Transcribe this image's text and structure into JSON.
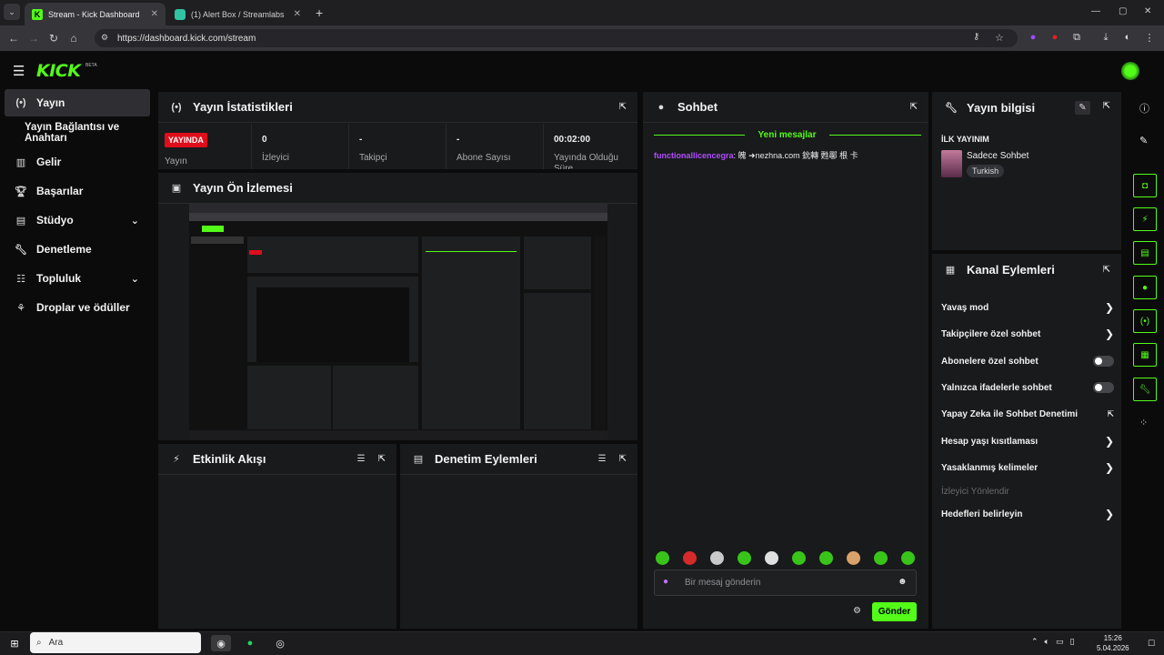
{
  "browser": {
    "tabs": [
      {
        "title": "Stream - Kick Dashboard",
        "active": true
      },
      {
        "title": "(1) Alert Box / Streamlabs",
        "active": false
      }
    ],
    "url": "https://dashboard.kick.com/stream"
  },
  "header": {
    "logo": "KICK",
    "beta": "BETA"
  },
  "sidebar": {
    "items": [
      {
        "label": "Yayın",
        "icon": "broadcast-icon"
      },
      {
        "label": "Yayın Bağlantısı ve Anahtarı"
      },
      {
        "label": "Gelir",
        "icon": "chart-icon"
      },
      {
        "label": "Başarılar",
        "icon": "trophy-icon"
      },
      {
        "label": "Stüdyo",
        "icon": "studio-icon"
      },
      {
        "label": "Denetleme",
        "icon": "wrench-icon"
      },
      {
        "label": "Topluluk",
        "icon": "community-icon"
      },
      {
        "label": "Droplar ve ödüller",
        "icon": "drops-icon"
      }
    ]
  },
  "stats": {
    "title": "Yayın İstatistikleri",
    "live_badge": "YAYINDA",
    "cells": [
      {
        "value": "",
        "label": "Yayın"
      },
      {
        "value": "0",
        "label": "İzleyici"
      },
      {
        "value": "-",
        "label": "Takipçi"
      },
      {
        "value": "-",
        "label": "Abone Sayısı"
      },
      {
        "value": "00:02:00",
        "label": "Yayında Olduğu Süre"
      }
    ]
  },
  "preview": {
    "title": "Yayın Ön İzlemesi"
  },
  "activity": {
    "title": "Etkinlik Akışı"
  },
  "moderation": {
    "title": "Denetim Eylemleri"
  },
  "chat": {
    "title": "Sohbet",
    "new_messages": "Yeni mesajlar",
    "message_user": "functionallicencegra",
    "message_text": ": 魄 ➜nezhna.com 鈗轉 甦鄳 根 卡",
    "input_placeholder": "Bir mesaj gönderin",
    "send_label": "Gönder"
  },
  "info": {
    "title": "Yayın bilgisi",
    "section_label": "İLK YAYINIM",
    "category": "Sadece Sohbet",
    "tag": "Turkish"
  },
  "channel_actions": {
    "title": "Kanal Eylemleri",
    "items": [
      {
        "label": "Yavaş mod",
        "control": "arrow"
      },
      {
        "label": "Takipçilere özel sohbet",
        "control": "arrow"
      },
      {
        "label": "Abonelere özel sohbet",
        "control": "toggle"
      },
      {
        "label": "Yalnızca ifadelerle sohbet",
        "control": "toggle"
      },
      {
        "label": "Yapay Zeka ile Sohbet Denetimi",
        "control": "external"
      },
      {
        "label": "Hesap yaşı kısıtlaması",
        "control": "arrow"
      },
      {
        "label": "Yasaklanmış kelimeler",
        "control": "arrow"
      },
      {
        "label": "İzleyici Yönlendir",
        "control": "disabled"
      },
      {
        "label": "Hedefleri belirleyin",
        "control": "arrow"
      }
    ]
  },
  "taskbar": {
    "search_placeholder": "Ara",
    "time": "15:26",
    "date": "5.04.2026"
  },
  "colors": {
    "accent": "#53fc18",
    "live": "#e00d1b",
    "chat_user": "#b04dff"
  }
}
